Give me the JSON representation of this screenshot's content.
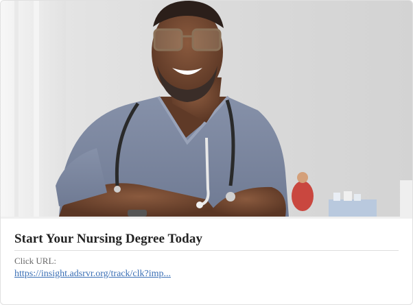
{
  "ad": {
    "headline": "Start Your Nursing Degree Today",
    "click_url_label": "Click URL:",
    "click_url": "https://insight.adsrvr.org/track/clk?imp...",
    "image_icon": "photo-nurse-icon"
  },
  "colors": {
    "link": "#3a6fb5",
    "headline": "#222222",
    "label": "#666666",
    "scrubs": "#7f8aa3",
    "background": "#dcdcdc"
  }
}
